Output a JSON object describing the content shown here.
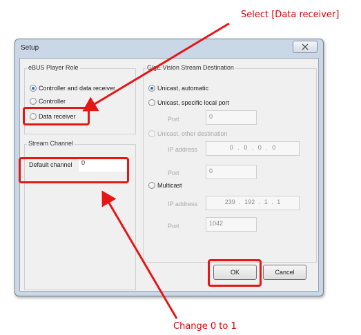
{
  "annotations": {
    "top_callout": "Select [Data receiver]",
    "bottom_callout": "Change 0 to 1",
    "highlight_color": "#e81515"
  },
  "dialog": {
    "title": "Setup",
    "close_icon": "close-x-icon",
    "player_role": {
      "title": "eBUS Player Role",
      "options": [
        "Controller and data receiver",
        "Controller",
        "Data receiver"
      ],
      "selected": "Controller and data receiver"
    },
    "stream_channel": {
      "title": "Stream Channel",
      "default_channel_label": "Default channel",
      "default_channel_value": "0"
    },
    "stream_destination": {
      "title": "GigE Vision Stream Destination",
      "unicast_auto": "Unicast, automatic",
      "unicast_specific": "Unicast, specific local port",
      "specific_port_label": "Port",
      "specific_port_value": "0",
      "unicast_other": "Unicast, other destination",
      "other_ip_label": "IP address",
      "other_ip_value": "0 . 0 . 0 . 0",
      "other_port_label": "Port",
      "other_port_value": "0",
      "multicast": "Multicast",
      "multicast_ip_label": "IP address",
      "multicast_ip_value": "239 . 192 . 1 . 1",
      "multicast_port_label": "Port",
      "multicast_port_value": "1042",
      "selected": "Unicast, automatic"
    },
    "buttons": {
      "ok": "OK",
      "cancel": "Cancel"
    }
  }
}
